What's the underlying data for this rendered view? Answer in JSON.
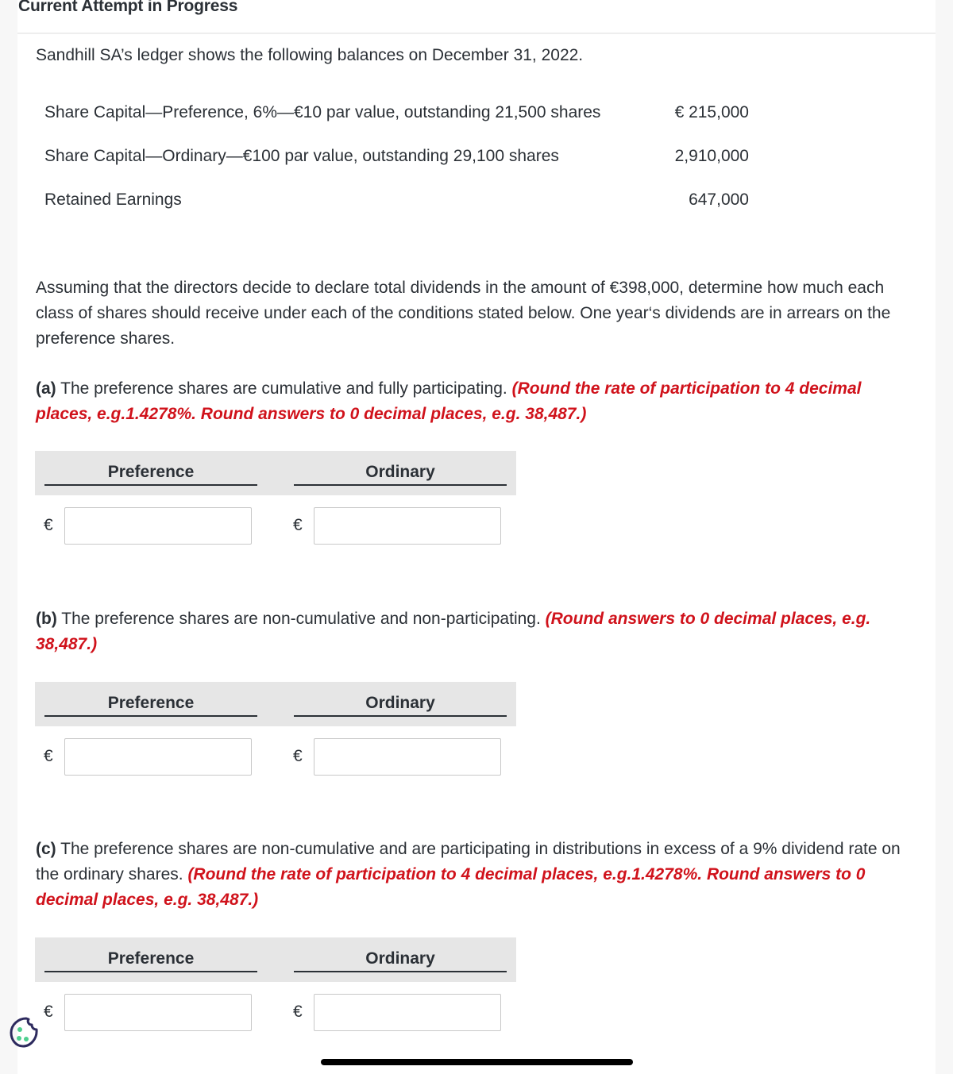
{
  "header": {
    "title": "Current Attempt in Progress"
  },
  "problem": {
    "intro": "Sandhill SA’s ledger shows the following balances on December 31, 2022.",
    "ledger": [
      {
        "label": "Share Capital—Preference, 6%—€10 par value, outstanding 21,500 shares",
        "amount": "€ 215,000"
      },
      {
        "label": "Share Capital—Ordinary—€100 par value, outstanding 29,100 shares",
        "amount": "2,910,000"
      },
      {
        "label": "Retained Earnings",
        "amount": "647,000"
      }
    ],
    "question": "Assuming that the directors decide to declare total dividends in the amount of €398,000, determine how much each class of shares should receive under each of the conditions stated below. One year‘s dividends are in arrears on the preference shares."
  },
  "parts": [
    {
      "label": "(a)",
      "text": " The preference shares are cumulative and fully participating. ",
      "instruction": "(Round the rate of participation to 4 decimal places, e.g.1.4278%. Round answers to 0 decimal places, e.g. 38,487.)",
      "columns": {
        "preference": "Preference",
        "ordinary": "Ordinary"
      },
      "currency_symbol": "€",
      "inputs": {
        "preference": "",
        "ordinary": ""
      }
    },
    {
      "label": "(b)",
      "text": " The preference shares are non-cumulative and non-participating. ",
      "instruction": "(Round answers to 0 decimal places, e.g. 38,487.)",
      "columns": {
        "preference": "Preference",
        "ordinary": "Ordinary"
      },
      "currency_symbol": "€",
      "inputs": {
        "preference": "",
        "ordinary": ""
      }
    },
    {
      "label": "(c)",
      "text": " The preference shares are non-cumulative and are participating in distributions in excess of a 9% dividend rate on the ordinary shares. ",
      "instruction": "(Round the rate of participation to 4 decimal places, e.g.1.4278%. Round answers to 0 decimal places, e.g. 38,487.)",
      "columns": {
        "preference": "Preference",
        "ordinary": "Ordinary"
      },
      "currency_symbol": "€",
      "inputs": {
        "preference": "",
        "ordinary": ""
      }
    }
  ],
  "colors": {
    "text": "#2b3036",
    "instruction_red": "#d0121b",
    "header_band": "#e6e6e6",
    "cookie_outline": "#2d2a5e",
    "cookie_dots": "#4fcf8f"
  },
  "icons": {
    "cookie": "cookie-settings-icon"
  }
}
